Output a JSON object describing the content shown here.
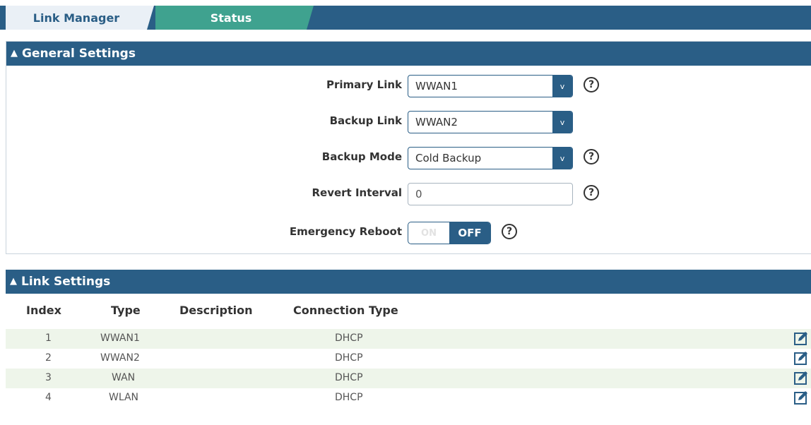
{
  "tabs": [
    {
      "label": "Link Manager"
    },
    {
      "label": "Status"
    }
  ],
  "general": {
    "title": "General Settings",
    "primary_link": {
      "label": "Primary Link",
      "value": "WWAN1"
    },
    "backup_link": {
      "label": "Backup Link",
      "value": "WWAN2"
    },
    "backup_mode": {
      "label": "Backup Mode",
      "value": "Cold Backup"
    },
    "revert_interval": {
      "label": "Revert Interval",
      "value": "0"
    },
    "emergency_reboot": {
      "label": "Emergency Reboot",
      "on_label": "ON",
      "off_label": "OFF",
      "state": "OFF"
    },
    "dropdown_glyph": "v",
    "help_glyph": "?"
  },
  "link_settings": {
    "title": "Link Settings",
    "columns": [
      "Index",
      "Type",
      "Description",
      "Connection Type"
    ],
    "rows": [
      {
        "index": "1",
        "type": "WWAN1",
        "description": "",
        "connection": "DHCP"
      },
      {
        "index": "2",
        "type": "WWAN2",
        "description": "",
        "connection": "DHCP"
      },
      {
        "index": "3",
        "type": "WAN",
        "description": "",
        "connection": "DHCP"
      },
      {
        "index": "4",
        "type": "WLAN",
        "description": "",
        "connection": "DHCP"
      }
    ]
  },
  "colors": {
    "header": "#2a5e86",
    "tab_active": "#eaf0f6",
    "tab_status": "#3fa28f",
    "row_alt": "#eef5ea"
  }
}
